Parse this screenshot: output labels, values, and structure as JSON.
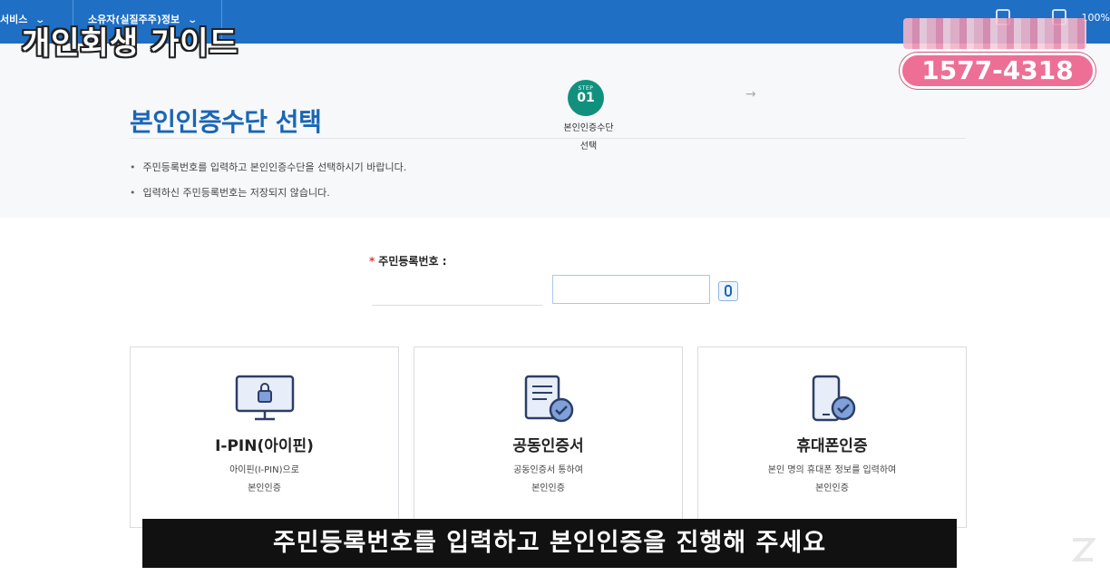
{
  "nav": {
    "items": [
      {
        "label": "서비스"
      },
      {
        "label": "소유자(실질주주)정보"
      }
    ],
    "zoom": "100%"
  },
  "overlay": {
    "guide_title": "개인회생 가이드",
    "phone": "1577-4318"
  },
  "header": {
    "page_title": "본인인증수단 선택",
    "step": {
      "label": "STEP",
      "number": "01",
      "caption_line1": "본인인증수단",
      "caption_line2": "선택"
    }
  },
  "notices": [
    "주민등록번호를 입력하고 본인인증수단을 선택하시기 바랍니다.",
    "입력하신 주민등록번호는 저장되지 않습니다."
  ],
  "form": {
    "required_mark": "*",
    "rrn_label": "주민등록번호 :",
    "rrn_front_value": "",
    "rrn_back_value": ""
  },
  "cards": [
    {
      "title": "I-PIN(아이핀)",
      "desc_line1": "아이핀(I-PIN)으로",
      "desc_line2": "본인인증",
      "icon": "monitor-lock-icon"
    },
    {
      "title": "공동인증서",
      "desc_line1": "공동인증서 통하여",
      "desc_line2": "본인인증",
      "icon": "certificate-check-icon"
    },
    {
      "title": "휴대폰인증",
      "desc_line1": "본인 명의 휴대폰 정보를 입력하여",
      "desc_line2": "본인인증",
      "icon": "phone-check-icon"
    }
  ],
  "subtitle": "주민등록번호를 입력하고 본인인증을 진행해 주세요",
  "colors": {
    "topbar": "#1f6fc5",
    "title_blue": "#1a66b5",
    "step_green": "#12907e",
    "phone_pink": "#ee6f96",
    "icon_blue": "#5b82c7"
  }
}
